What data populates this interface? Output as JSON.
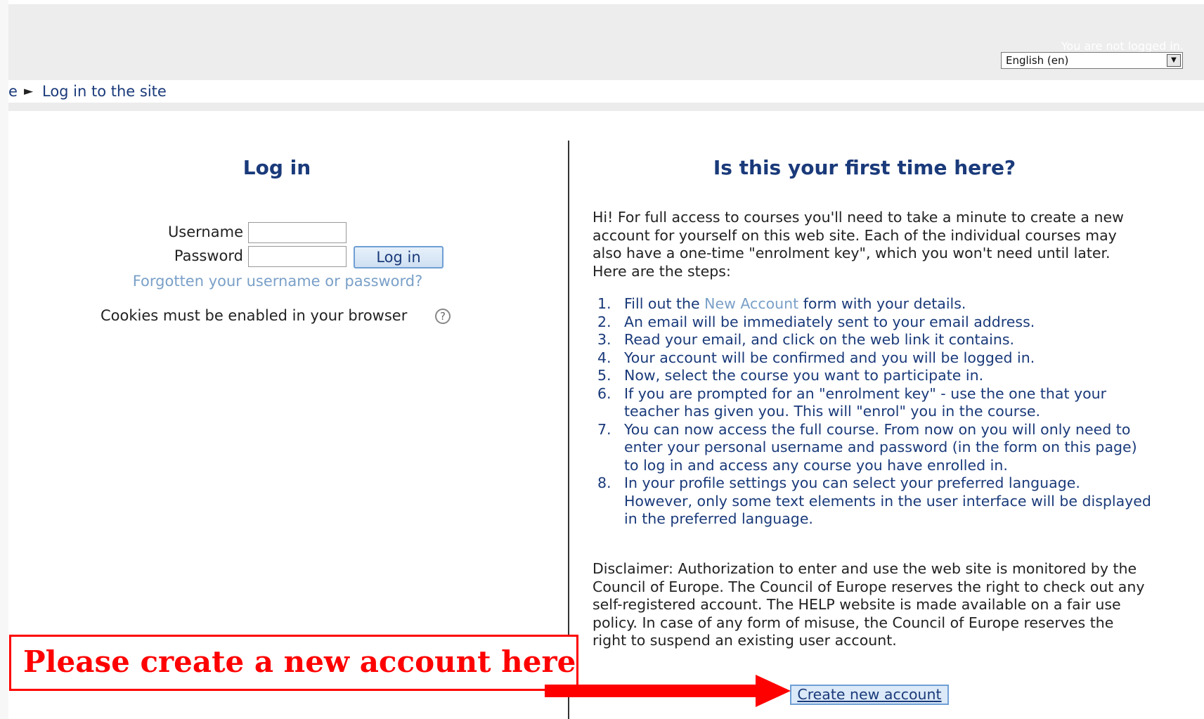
{
  "header": {
    "login_status": "You are not logged in.",
    "language_select": {
      "selected": "English (en)"
    }
  },
  "breadcrumb": {
    "prefix": "e",
    "arrow": "►",
    "current": "Log in to the site"
  },
  "login": {
    "heading": "Log in",
    "username_label": "Username",
    "password_label": "Password",
    "username_value": "",
    "password_value": "",
    "submit_label": "Log in",
    "forgot_link": "Forgotten your username or password?",
    "cookies_note": "Cookies must be enabled in your browser",
    "help_icon_glyph": "?"
  },
  "signup": {
    "heading": "Is this your first time here?",
    "intro": "Hi! For full access to courses you'll need to take a minute to create a new account for yourself on this web site. Each of the individual courses may also have a one-time \"enrolment key\", which you won't need until later. Here are the steps:",
    "steps": [
      {
        "num": "1.",
        "before": "Fill out the ",
        "link": "New Account",
        "after": " form with your details."
      },
      {
        "num": "2.",
        "text": "An email will be immediately sent to your email address."
      },
      {
        "num": "3.",
        "text": "Read your email, and click on the web link it contains."
      },
      {
        "num": "4.",
        "text": "Your account will be confirmed and you will be logged in."
      },
      {
        "num": "5.",
        "text": "Now, select the course you want to participate in."
      },
      {
        "num": "6.",
        "text": "If you are prompted for an \"enrolment key\" - use the one that your teacher has given you. This will \"enrol\" you in the course."
      },
      {
        "num": "7.",
        "text": "You can now access the full course. From now on you will only need to enter your personal username and password (in the form on this page) to log in and access any course you have enrolled in."
      },
      {
        "num": "8.",
        "text": "In your profile settings you can select your preferred language. However, only some text elements in the user interface will be displayed in the preferred language."
      }
    ],
    "disclaimer": "Disclaimer: Authorization to enter and use the web site is monitored by the Council of Europe. The Council of Europe reserves the right to check out any self-registered account. The HELP website is made available on a fair use policy. In case of any form of misuse, the Council of Europe reserves the right to suspend an existing user account.",
    "create_button": "Create new account"
  },
  "annotation": {
    "callout_text": "Please create a new account here",
    "color": "#ff0000"
  },
  "colors": {
    "heading_blue": "#1a3a7a",
    "link_light_blue": "#7aa0c8",
    "header_bg": "#ededed"
  },
  "icons": {
    "dropdown": "chevron-down-icon",
    "help": "help-icon",
    "breadcrumb_sep": "triangle-right-icon"
  }
}
